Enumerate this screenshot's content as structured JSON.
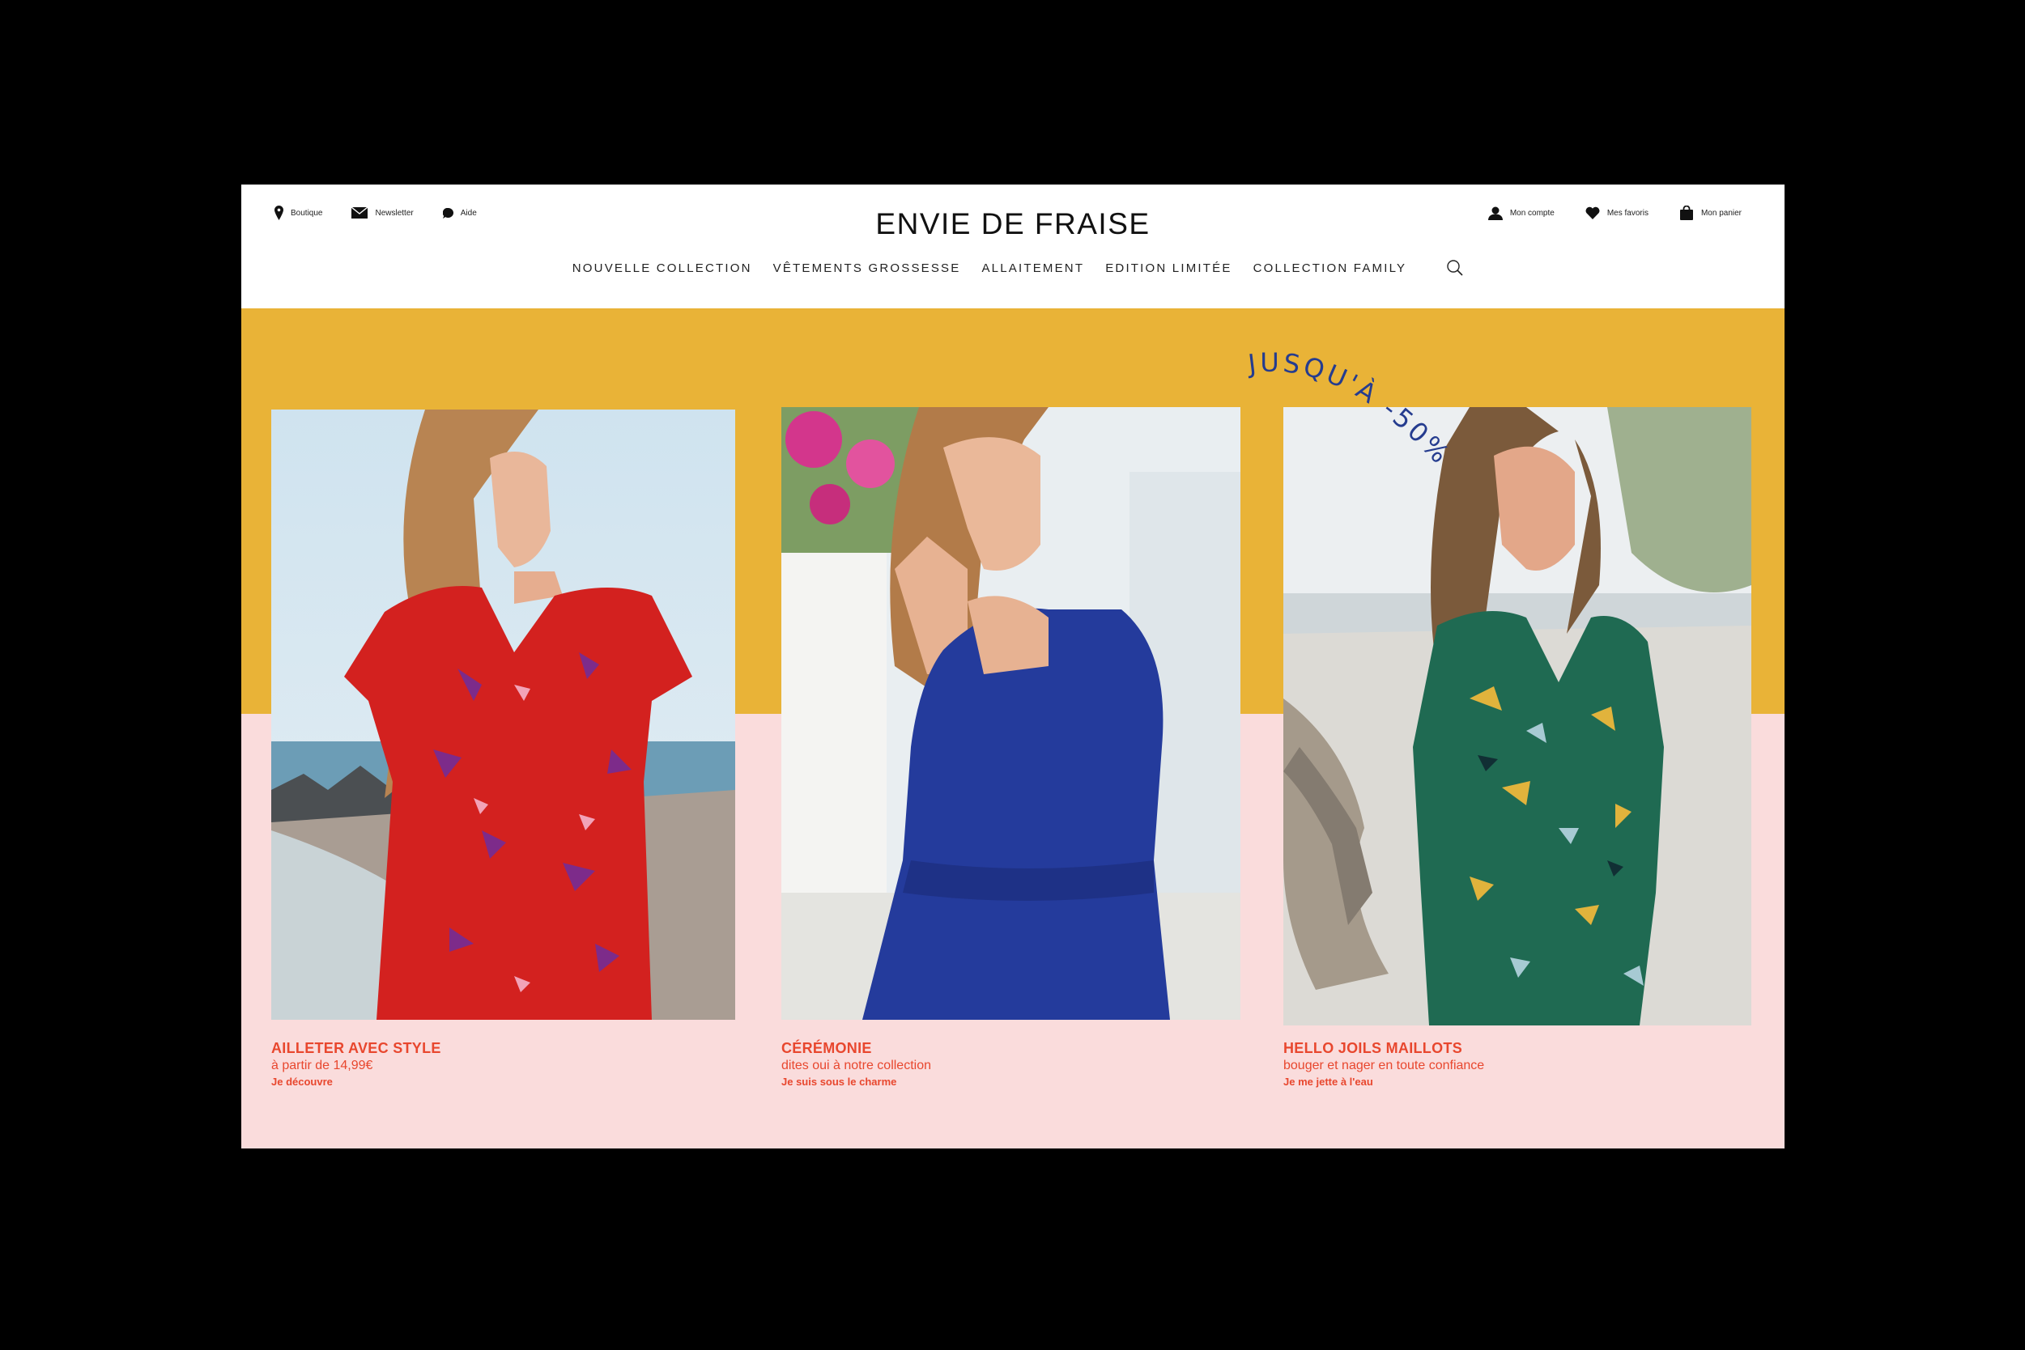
{
  "header": {
    "brand": "ENVIE DE FRAISE",
    "left_links": [
      {
        "label": "Boutique",
        "icon": "location-pin-icon"
      },
      {
        "label": "Newsletter",
        "icon": "envelope-icon"
      },
      {
        "label": "Aide",
        "icon": "chat-bubble-icon"
      }
    ],
    "right_links": [
      {
        "label": "Mon compte",
        "icon": "user-icon"
      },
      {
        "label": "Mes favoris",
        "icon": "heart-icon"
      },
      {
        "label": "Mon panier",
        "icon": "shopping-bag-icon"
      }
    ],
    "nav": [
      "NOUVELLE COLLECTION",
      "VÊTEMENTS GROSSESSE",
      "ALLAITEMENT",
      "EDITION LIMITÉE",
      "COLLECTION FAMILY"
    ],
    "search_icon": "search-icon"
  },
  "hero": {
    "promo_text": "JUSQU'À -50%",
    "colors": {
      "yellow": "#e9b337",
      "pink": "#fadcdc",
      "promo": "#253c8f",
      "card_text": "#e8472e"
    },
    "cards": [
      {
        "title": "AILLETER AVEC STYLE",
        "subtitle": "à partir de 14,99€",
        "cta": "Je découvre"
      },
      {
        "title": "CÉRÉMONIE",
        "subtitle": "dites oui à notre collection",
        "cta": "Je suis sous le charme"
      },
      {
        "title": "HELLO JOILS MAILLOTS",
        "subtitle": "bouger et nager en toute confiance",
        "cta": "Je me jette à l'eau"
      }
    ]
  }
}
